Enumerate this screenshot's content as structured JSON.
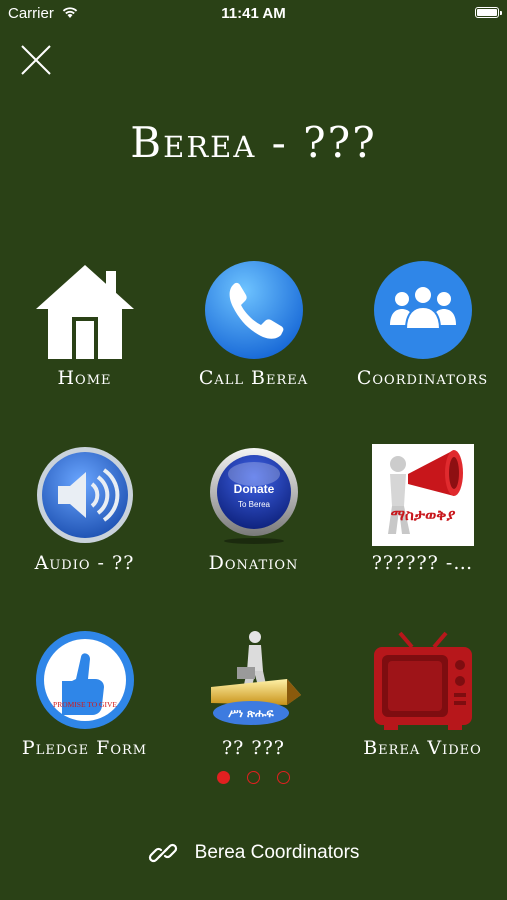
{
  "status_bar": {
    "carrier": "Carrier",
    "time": "11:41 AM"
  },
  "header": {
    "title": "Berea - ???"
  },
  "menu": {
    "items": [
      {
        "label": "Home",
        "icon": "house-icon"
      },
      {
        "label": "Call Berea",
        "icon": "phone-icon"
      },
      {
        "label": "Coordinators",
        "icon": "people-group-icon"
      },
      {
        "label": "Audio - ??",
        "icon": "speaker-icon"
      },
      {
        "label": "Donation",
        "icon": "donate-button-icon",
        "icon_text_top": "Donate",
        "icon_text_bottom": "To Berea"
      },
      {
        "label": "?????? -…",
        "icon": "megaphone-icon",
        "icon_text": "ማስታወቅያ"
      },
      {
        "label": "Pledge Form",
        "icon": "pledge-thumb-icon",
        "icon_text": "PROMISE TO GIVE"
      },
      {
        "label": "?? ???",
        "icon": "writer-pen-icon",
        "icon_text": "ሥነ ጽሑፍ"
      },
      {
        "label": "Berea Video",
        "icon": "tv-icon"
      }
    ]
  },
  "pager": {
    "current": 1,
    "total": 3
  },
  "footer": {
    "label": "Berea Coordinators"
  },
  "colors": {
    "background": "#2a4116",
    "accent": "#e02020",
    "blue": "#2f86e8"
  }
}
